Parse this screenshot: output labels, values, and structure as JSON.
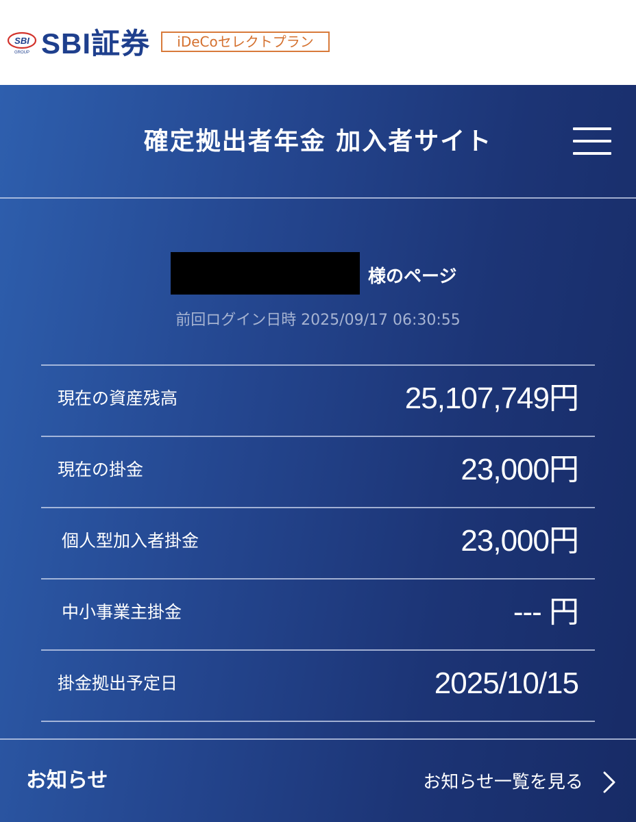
{
  "header": {
    "logo_mark_text": "SBI",
    "logo_sub_text": "GROUP",
    "brand_name": "SBI証券",
    "plan_badge": "iDeCoセレクトプラン"
  },
  "site": {
    "title": "確定拠出者年金 加入者サイト",
    "menu_icon": "hamburger-menu-icon"
  },
  "account": {
    "owner_suffix": "様のページ",
    "last_login_label": "前回ログイン日時",
    "last_login_datetime": "2025/09/17 06:30:55",
    "last_login_display": "前回ログイン日時  2025/09/17 06:30:55"
  },
  "summary": {
    "rows": [
      {
        "label": "現在の資産残高",
        "value": "25,107,749円"
      },
      {
        "label": "現在の掛金",
        "value": "23,000円"
      },
      {
        "label": "個人型加入者掛金",
        "value": "23,000円"
      },
      {
        "label": "中小事業主掛金",
        "value": "--- 円"
      },
      {
        "label": "掛金拠出予定日",
        "value": "2025/10/15"
      }
    ]
  },
  "notices": {
    "title": "お知らせ",
    "view_all_label": "お知らせ一覧を見る",
    "link_icon": "chevron-right-icon"
  },
  "colors": {
    "brand_navy": "#1e3f8d",
    "badge_orange": "#d87a3a",
    "logo_red": "#d2322b",
    "panel_gradient_start": "#2e5fae",
    "panel_gradient_end": "#172b66",
    "muted_text": "#a7b4d2"
  }
}
